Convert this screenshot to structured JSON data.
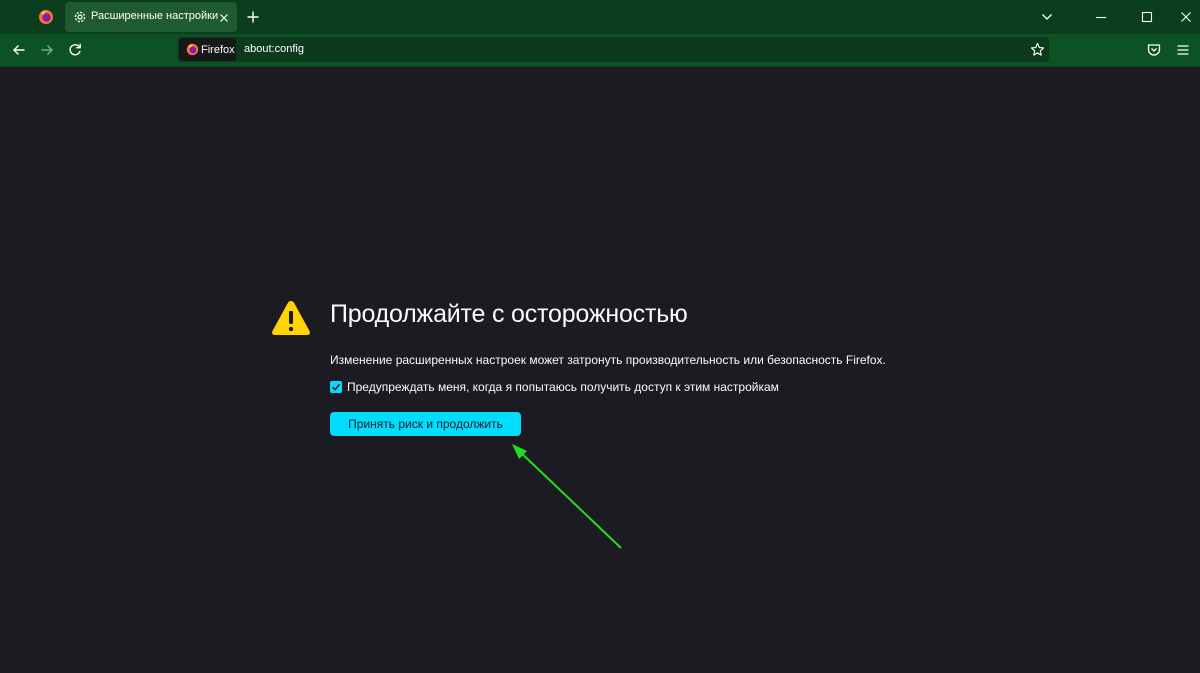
{
  "tabbar": {
    "tab_title": "Расширенные настройки"
  },
  "navbar": {
    "identity_label": "Firefox",
    "url": "about:config"
  },
  "page": {
    "title": "Продолжайте с осторожностью",
    "description": "Изменение расширенных настроек может затронуть производительность или безопасность Firefox.",
    "checkbox_label": "Предупреждать меня, когда я попытаюсь получить доступ к этим настройкам",
    "checkbox_checked": true,
    "accept_button_label": "Принять риск и продолжить"
  },
  "colors": {
    "accent": "#00ddff",
    "warning": "#ffd400",
    "annotation_arrow": "#22dd22",
    "toolbar": "#0d5225",
    "tabbar": "#0a3e1e",
    "page_bg": "#1c1b22"
  }
}
